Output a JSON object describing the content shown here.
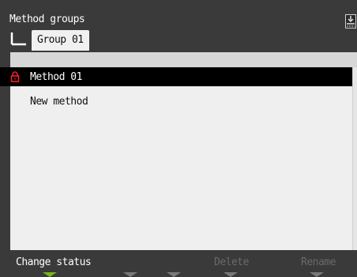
{
  "header": {
    "title": "Method groups",
    "tab_label": "Group 01"
  },
  "list": {
    "items": [
      {
        "label": "Method 01",
        "locked": true,
        "selected": true
      },
      {
        "label": "New method",
        "locked": false,
        "selected": false
      }
    ]
  },
  "softkeys": {
    "key1": "Change status",
    "key2": "",
    "key3": "",
    "key4": "Delete",
    "key5": "Rename"
  },
  "colors": {
    "background": "#3a3a3a",
    "panel": "#efefef",
    "selection": "#000000",
    "lock": "#e8202a",
    "softkey_active_indicator": "#7ab31c"
  }
}
